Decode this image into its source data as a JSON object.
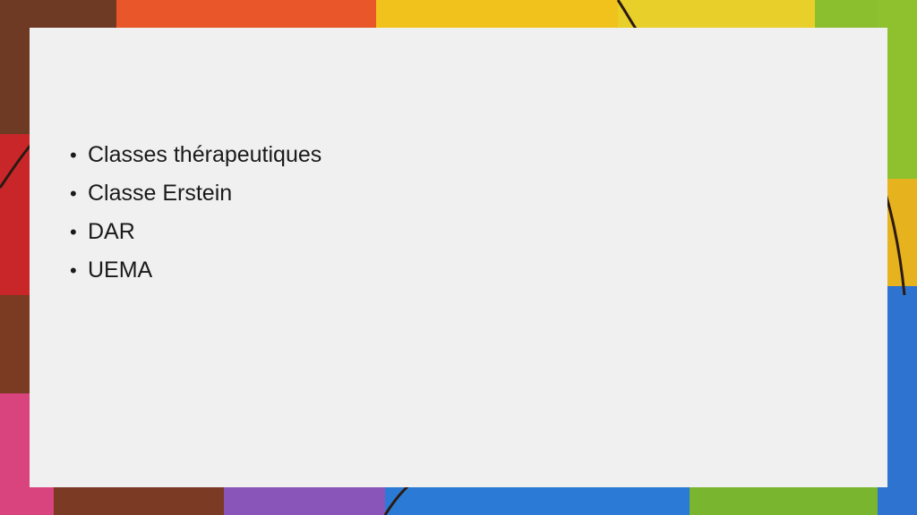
{
  "slide": {
    "bullets": [
      "Classes thérapeutiques",
      "Classe Erstein",
      "DAR",
      "UEMA"
    ],
    "bullet_glyph": "•"
  },
  "background": {
    "description_colors": [
      "#7a3b1e",
      "#e8552a",
      "#f5c41a",
      "#8dbf2e",
      "#3fa34a",
      "#2a6fd1",
      "#8a4fb5",
      "#d64a8a",
      "#c82a2a"
    ]
  }
}
